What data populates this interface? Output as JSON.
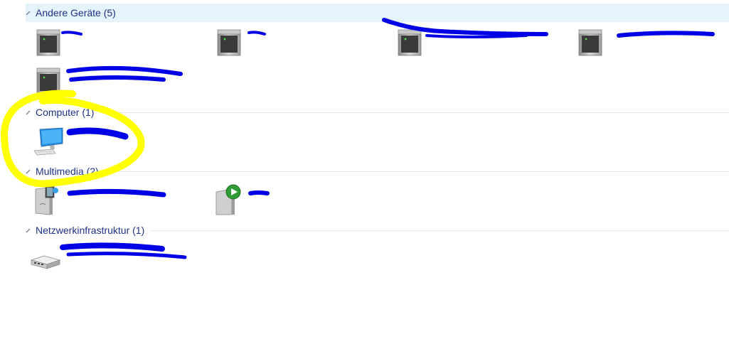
{
  "groups": {
    "andere_geraete": {
      "title": "Andere Geräte (5)"
    },
    "computer": {
      "title": "Computer (1)"
    },
    "multimedia": {
      "title": "Multimedia (2)"
    },
    "netzwerk": {
      "title": "Netzwerkinfrastruktur (1)"
    }
  },
  "icons": {
    "server": "server-tower-icon",
    "computer": "desktop-computer-icon",
    "media_server": "media-server-icon",
    "media_player": "media-player-icon",
    "router": "network-router-icon"
  },
  "colors": {
    "header_text": "#1e3287",
    "header_selected_bg": "#e5f3fb",
    "redaction": "#0000e6",
    "highlight": "#ffff00"
  }
}
